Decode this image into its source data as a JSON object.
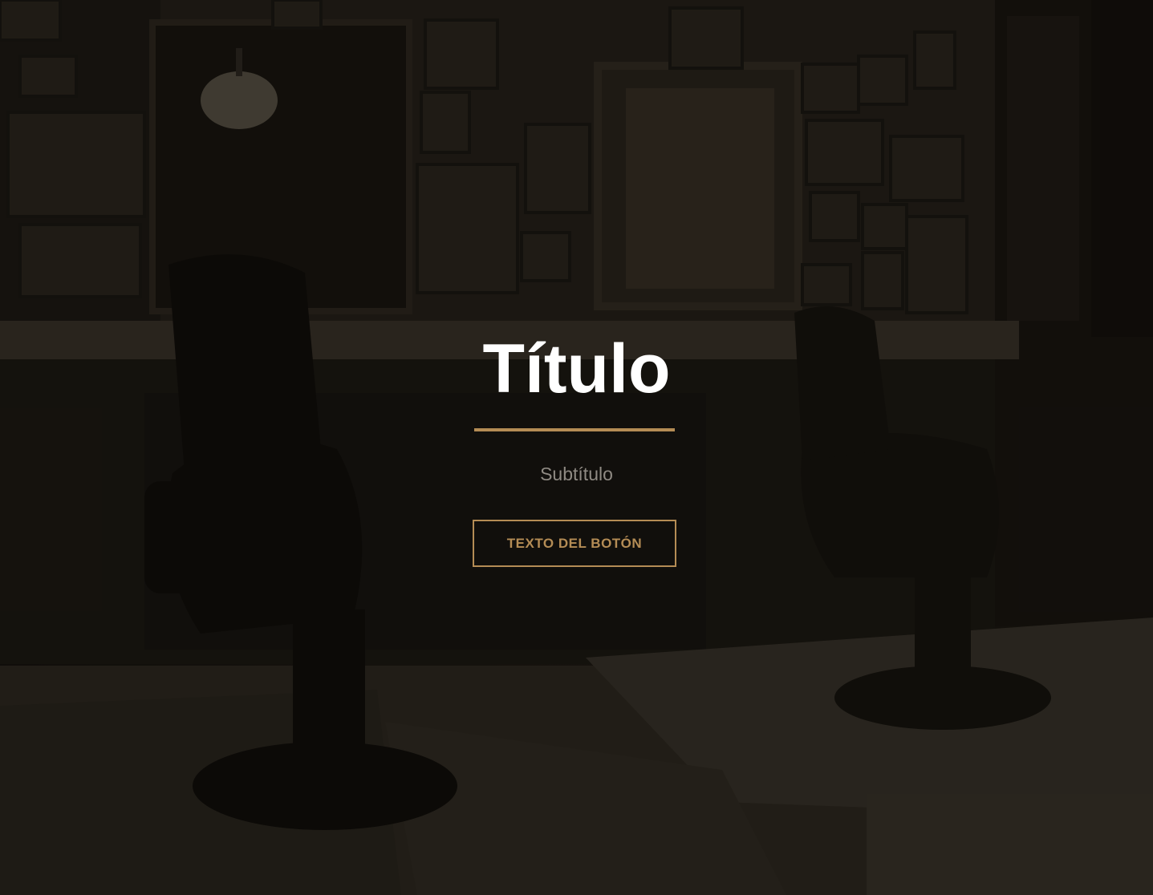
{
  "hero": {
    "title": "Título",
    "subtitle": "Subtítulo",
    "button_label": "TEXTO DEL BOTÓN",
    "background_image": "barbershop-interior-photo"
  },
  "colors": {
    "accent": "#b48c55",
    "title": "#ffffff",
    "subtitle": "#8f8a83",
    "background": "#14110d"
  }
}
